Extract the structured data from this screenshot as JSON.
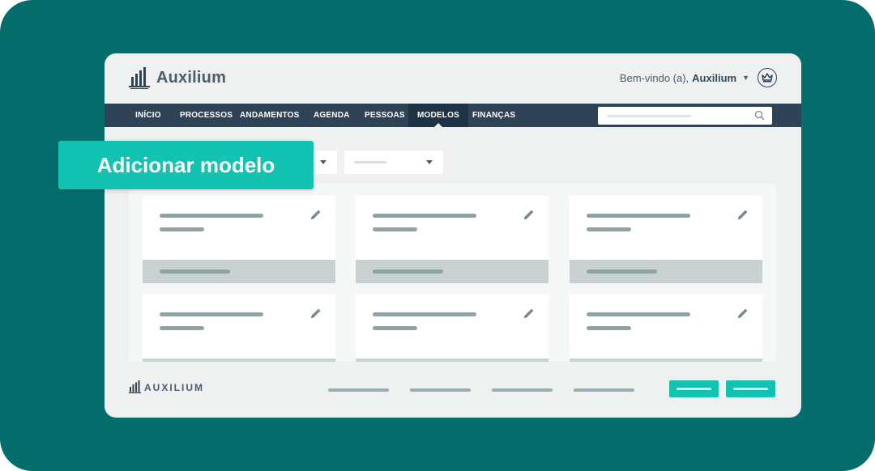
{
  "app": {
    "logo_text": "Auxilium",
    "footer_logo_text": "AUXILIUM",
    "welcome_text": "Bem-vindo (a),",
    "user_name": "Auxilium"
  },
  "nav": {
    "items": [
      {
        "label": "INÍCIO"
      },
      {
        "label": "PROCESSOS"
      },
      {
        "label": "ANDAMENTOS"
      },
      {
        "label": "AGENDA"
      },
      {
        "label": "PESSOAS"
      },
      {
        "label": "MODELOS",
        "active": true
      },
      {
        "label": "FINANÇAS"
      }
    ]
  },
  "callout": {
    "label": "Adicionar modelo"
  },
  "icons": {
    "logo": "building-columns-icon",
    "account": "crown-icon",
    "search": "search-icon",
    "edit": "pencil-icon",
    "dropdown": "caret-down-icon"
  },
  "colors": {
    "background": "#066d6d",
    "nav": "#2f4356",
    "accent": "#13c3b1",
    "window": "#eff0f0"
  }
}
